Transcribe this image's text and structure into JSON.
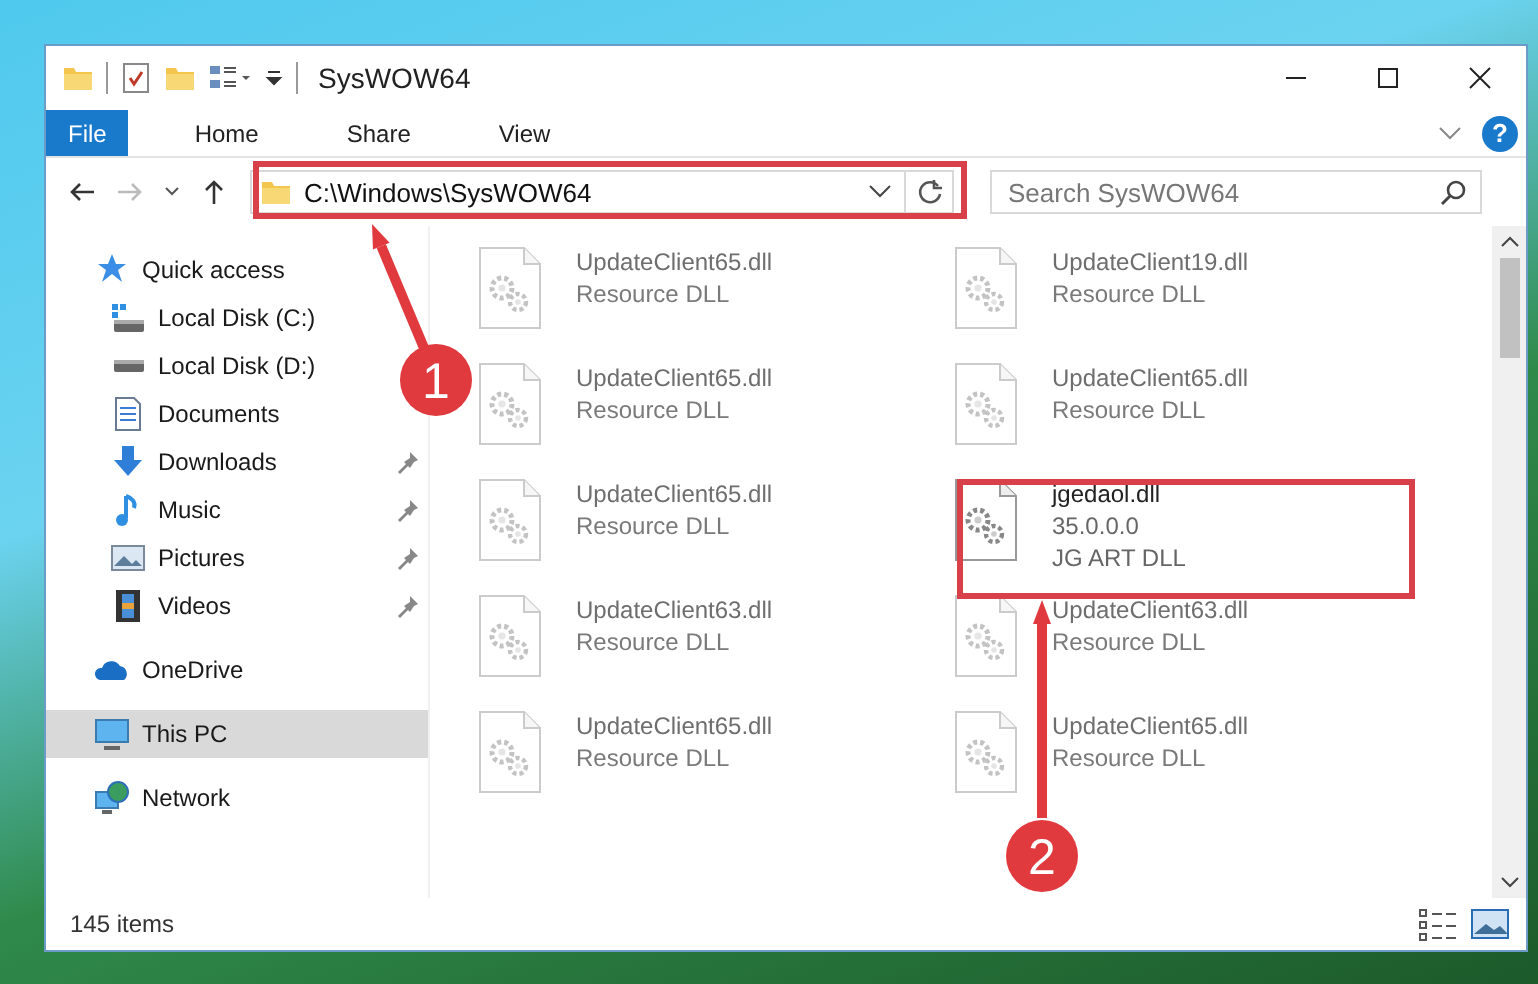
{
  "window": {
    "title": "SysWOW64"
  },
  "ribbon": {
    "tabs": [
      {
        "label": "File",
        "selected": true
      },
      {
        "label": "Home",
        "selected": false
      },
      {
        "label": "Share",
        "selected": false
      },
      {
        "label": "View",
        "selected": false
      }
    ],
    "help": "?"
  },
  "address_bar": {
    "path": "C:\\Windows\\SysWOW64"
  },
  "search": {
    "placeholder": "Search SysWOW64"
  },
  "sidebar": {
    "items": [
      {
        "label": "Quick access",
        "kind": "star",
        "selected": false,
        "children": [
          {
            "label": "Local Disk (C:)",
            "kind": "drive-c",
            "pinned": false
          },
          {
            "label": "Local Disk (D:)",
            "kind": "drive",
            "pinned": false
          },
          {
            "label": "Documents",
            "kind": "documents",
            "pinned": false
          },
          {
            "label": "Downloads",
            "kind": "downloads",
            "pinned": true
          },
          {
            "label": "Music",
            "kind": "music",
            "pinned": true
          },
          {
            "label": "Pictures",
            "kind": "pictures",
            "pinned": true
          },
          {
            "label": "Videos",
            "kind": "videos",
            "pinned": true
          }
        ]
      },
      {
        "label": "OneDrive",
        "kind": "cloud",
        "selected": false
      },
      {
        "label": "This PC",
        "kind": "pc",
        "selected": true
      },
      {
        "label": "Network",
        "kind": "network",
        "selected": false
      }
    ]
  },
  "files": [
    {
      "name": "UpdateClient65.dll",
      "lines": [
        "Resource DLL"
      ],
      "faded": true
    },
    {
      "name": "UpdateClient19.dll",
      "lines": [
        "Resource DLL"
      ],
      "faded": true
    },
    {
      "name": "UpdateClient65.dll",
      "lines": [
        "Resource DLL"
      ],
      "faded": true
    },
    {
      "name": "UpdateClient65.dll",
      "lines": [
        "Resource DLL"
      ],
      "faded": true
    },
    {
      "name": "UpdateClient65.dll",
      "lines": [
        "Resource DLL"
      ],
      "faded": true
    },
    {
      "name": "jgedaol.dll",
      "lines": [
        "35.0.0.0",
        "JG ART DLL"
      ],
      "faded": false
    },
    {
      "name": "UpdateClient63.dll",
      "lines": [
        "Resource DLL"
      ],
      "faded": true
    },
    {
      "name": "UpdateClient63.dll",
      "lines": [
        "Resource DLL"
      ],
      "faded": true
    },
    {
      "name": "UpdateClient65.dll",
      "lines": [
        "Resource DLL"
      ],
      "faded": true
    },
    {
      "name": "UpdateClient65.dll",
      "lines": [
        "Resource DLL"
      ],
      "faded": true
    }
  ],
  "status_bar": {
    "item_count": "145 items"
  },
  "annotations": [
    {
      "number": "1"
    },
    {
      "number": "2"
    }
  ]
}
